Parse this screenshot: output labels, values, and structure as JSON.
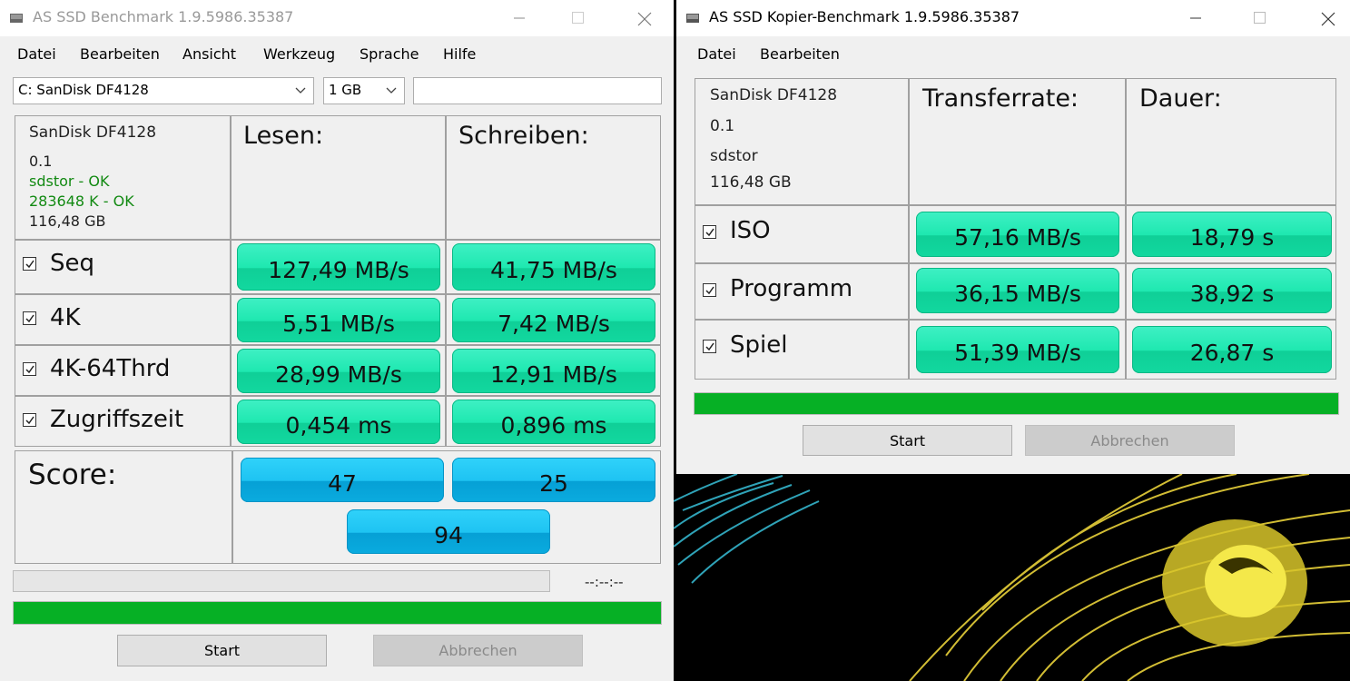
{
  "benchmark": {
    "title": "AS SSD Benchmark 1.9.5986.35387",
    "menu": [
      "Datei",
      "Bearbeiten",
      "Ansicht",
      "Werkzeug",
      "Sprache",
      "Hilfe"
    ],
    "drive_select": "C: SanDisk DF4128",
    "size_select": "1 GB",
    "text_field": "",
    "info": {
      "model": "SanDisk DF4128",
      "firmware": "0.1",
      "driver": "sdstor - OK",
      "alignment": "283648 K - OK",
      "capacity": "116,48 GB"
    },
    "headers": {
      "read": "Lesen:",
      "write": "Schreiben:"
    },
    "rows": [
      {
        "label": "Seq",
        "read": "127,49 MB/s",
        "write": "41,75 MB/s"
      },
      {
        "label": "4K",
        "read": "5,51 MB/s",
        "write": "7,42 MB/s"
      },
      {
        "label": "4K-64Thrd",
        "read": "28,99 MB/s",
        "write": "12,91 MB/s"
      },
      {
        "label": "Zugriffszeit",
        "read": "0,454 ms",
        "write": "0,896 ms"
      }
    ],
    "score": {
      "label": "Score:",
      "read": "47",
      "write": "25",
      "total": "94"
    },
    "timer": "--:--:--",
    "progress": 1.0,
    "start_label": "Start",
    "abort_label": "Abbrechen"
  },
  "copy_benchmark": {
    "title": "AS SSD Kopier-Benchmark 1.9.5986.35387",
    "menu": [
      "Datei",
      "Bearbeiten"
    ],
    "info": {
      "model": "SanDisk DF4128",
      "firmware": "0.1",
      "driver": "sdstor",
      "capacity": "116,48 GB"
    },
    "headers": {
      "rate": "Transferrate:",
      "duration": "Dauer:"
    },
    "rows": [
      {
        "label": "ISO",
        "rate": "57,16 MB/s",
        "duration": "18,79 s"
      },
      {
        "label": "Programm",
        "rate": "36,15 MB/s",
        "duration": "38,92 s"
      },
      {
        "label": "Spiel",
        "rate": "51,39 MB/s",
        "duration": "26,87 s"
      }
    ],
    "progress": 1.0,
    "start_label": "Start",
    "abort_label": "Abbrechen"
  },
  "colors": {
    "value_box": "#1ee8b0",
    "score_box": "#1ec3f2",
    "progress": "#06b025",
    "ok_text": "#138a13"
  }
}
